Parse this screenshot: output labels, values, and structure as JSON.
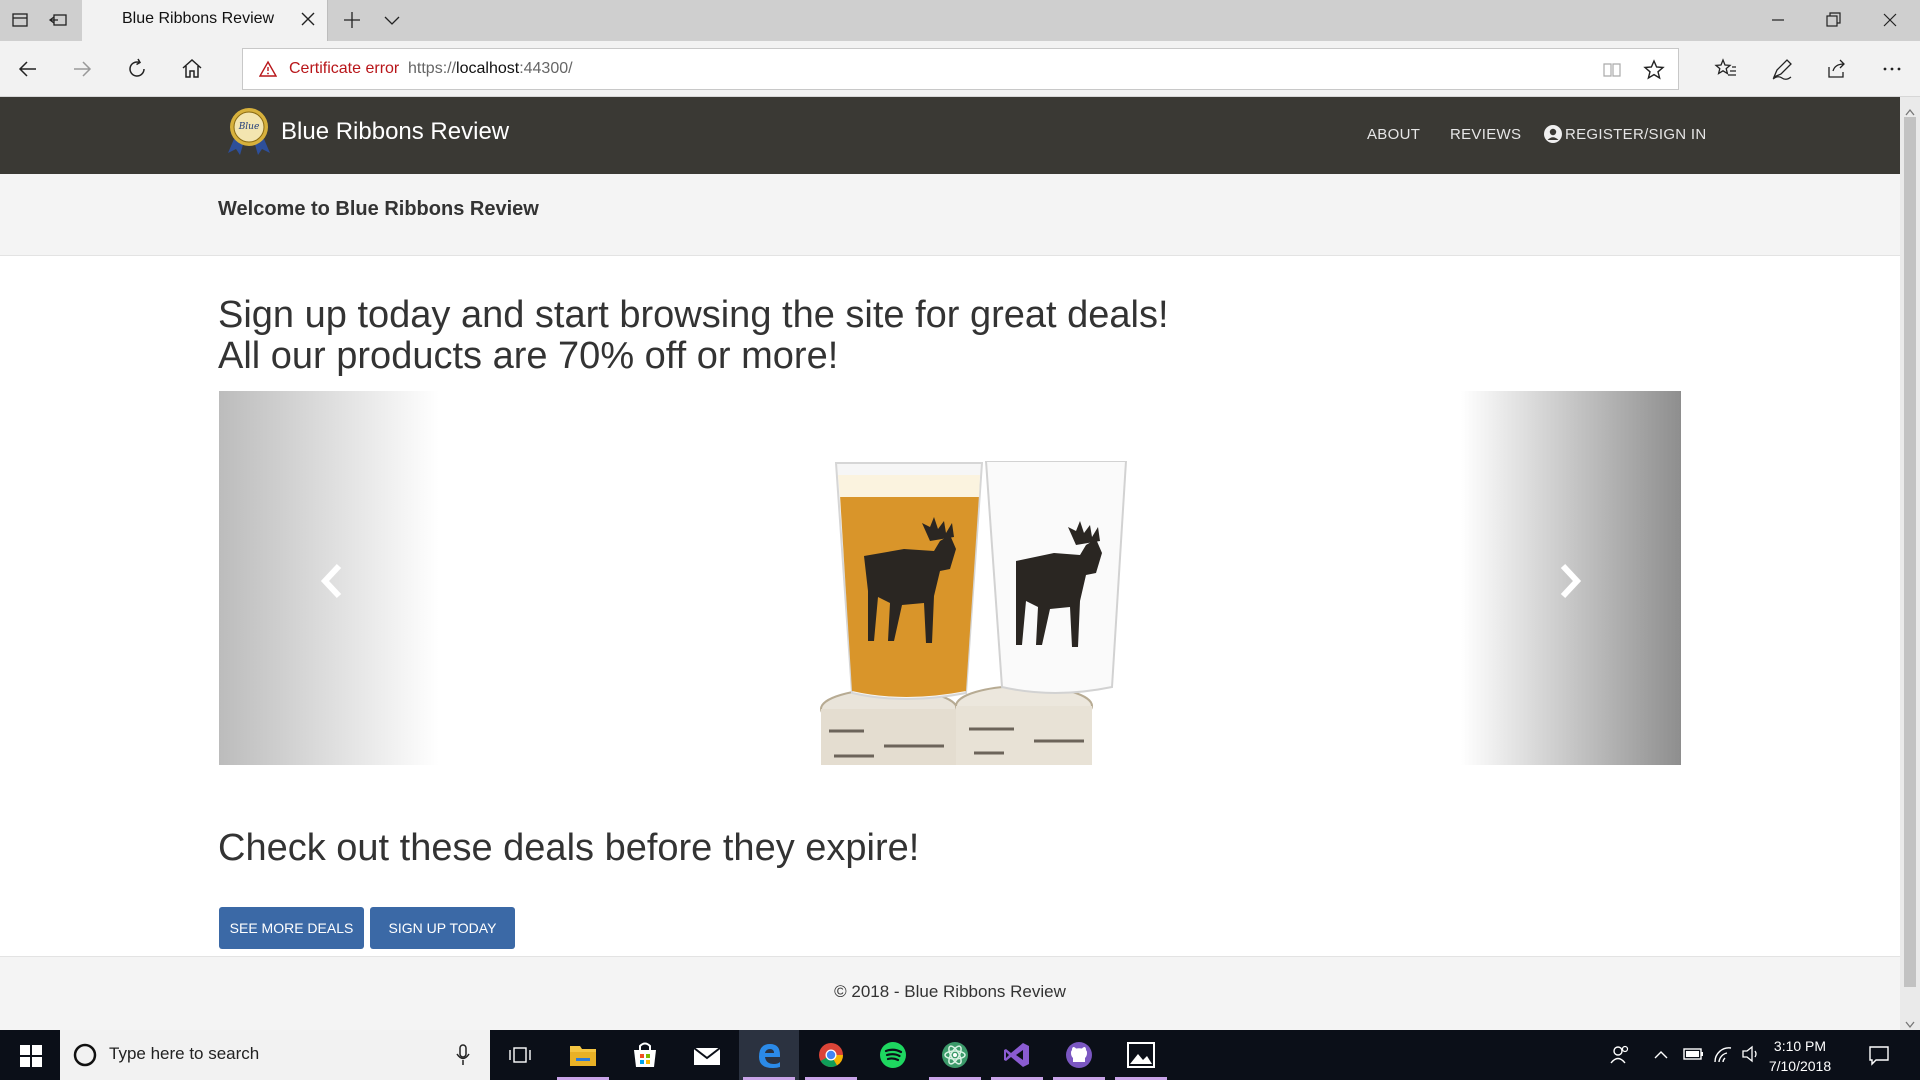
{
  "browser": {
    "tab_title": "Blue Ribbons Review",
    "cert_error": "Certificate error",
    "url_prefix": "https://",
    "url_host": "localhost",
    "url_port": ":44300/"
  },
  "site": {
    "brand": "Blue Ribbons Review",
    "logo_text": "Blue",
    "nav": {
      "about": "ABOUT",
      "reviews": "REVIEWS",
      "register": "REGISTER/SIGN IN"
    },
    "welcome": "Welcome to Blue Ribbons Review",
    "headline_1": "Sign up today and start browsing the site for great deals!",
    "headline_2": "All our products are 70% off or more!",
    "deals_heading": "Check out these deals before they expire!",
    "buttons": {
      "see_more": "SEE MORE DEALS",
      "sign_up": "SIGN UP TODAY"
    },
    "footer": "© 2018 - Blue Ribbons Review",
    "colors": {
      "navbar": "#3a3934",
      "button": "#3b69a6",
      "cert_error": "#b8161a"
    }
  },
  "taskbar": {
    "search_placeholder": "Type here to search",
    "time": "3:10 PM",
    "date": "7/10/2018",
    "apps": [
      "file-explorer-icon",
      "store-icon",
      "mail-icon",
      "edge-icon",
      "chrome-icon",
      "spotify-icon",
      "atom-icon",
      "visual-studio-icon",
      "github-icon",
      "photos-icon"
    ]
  }
}
